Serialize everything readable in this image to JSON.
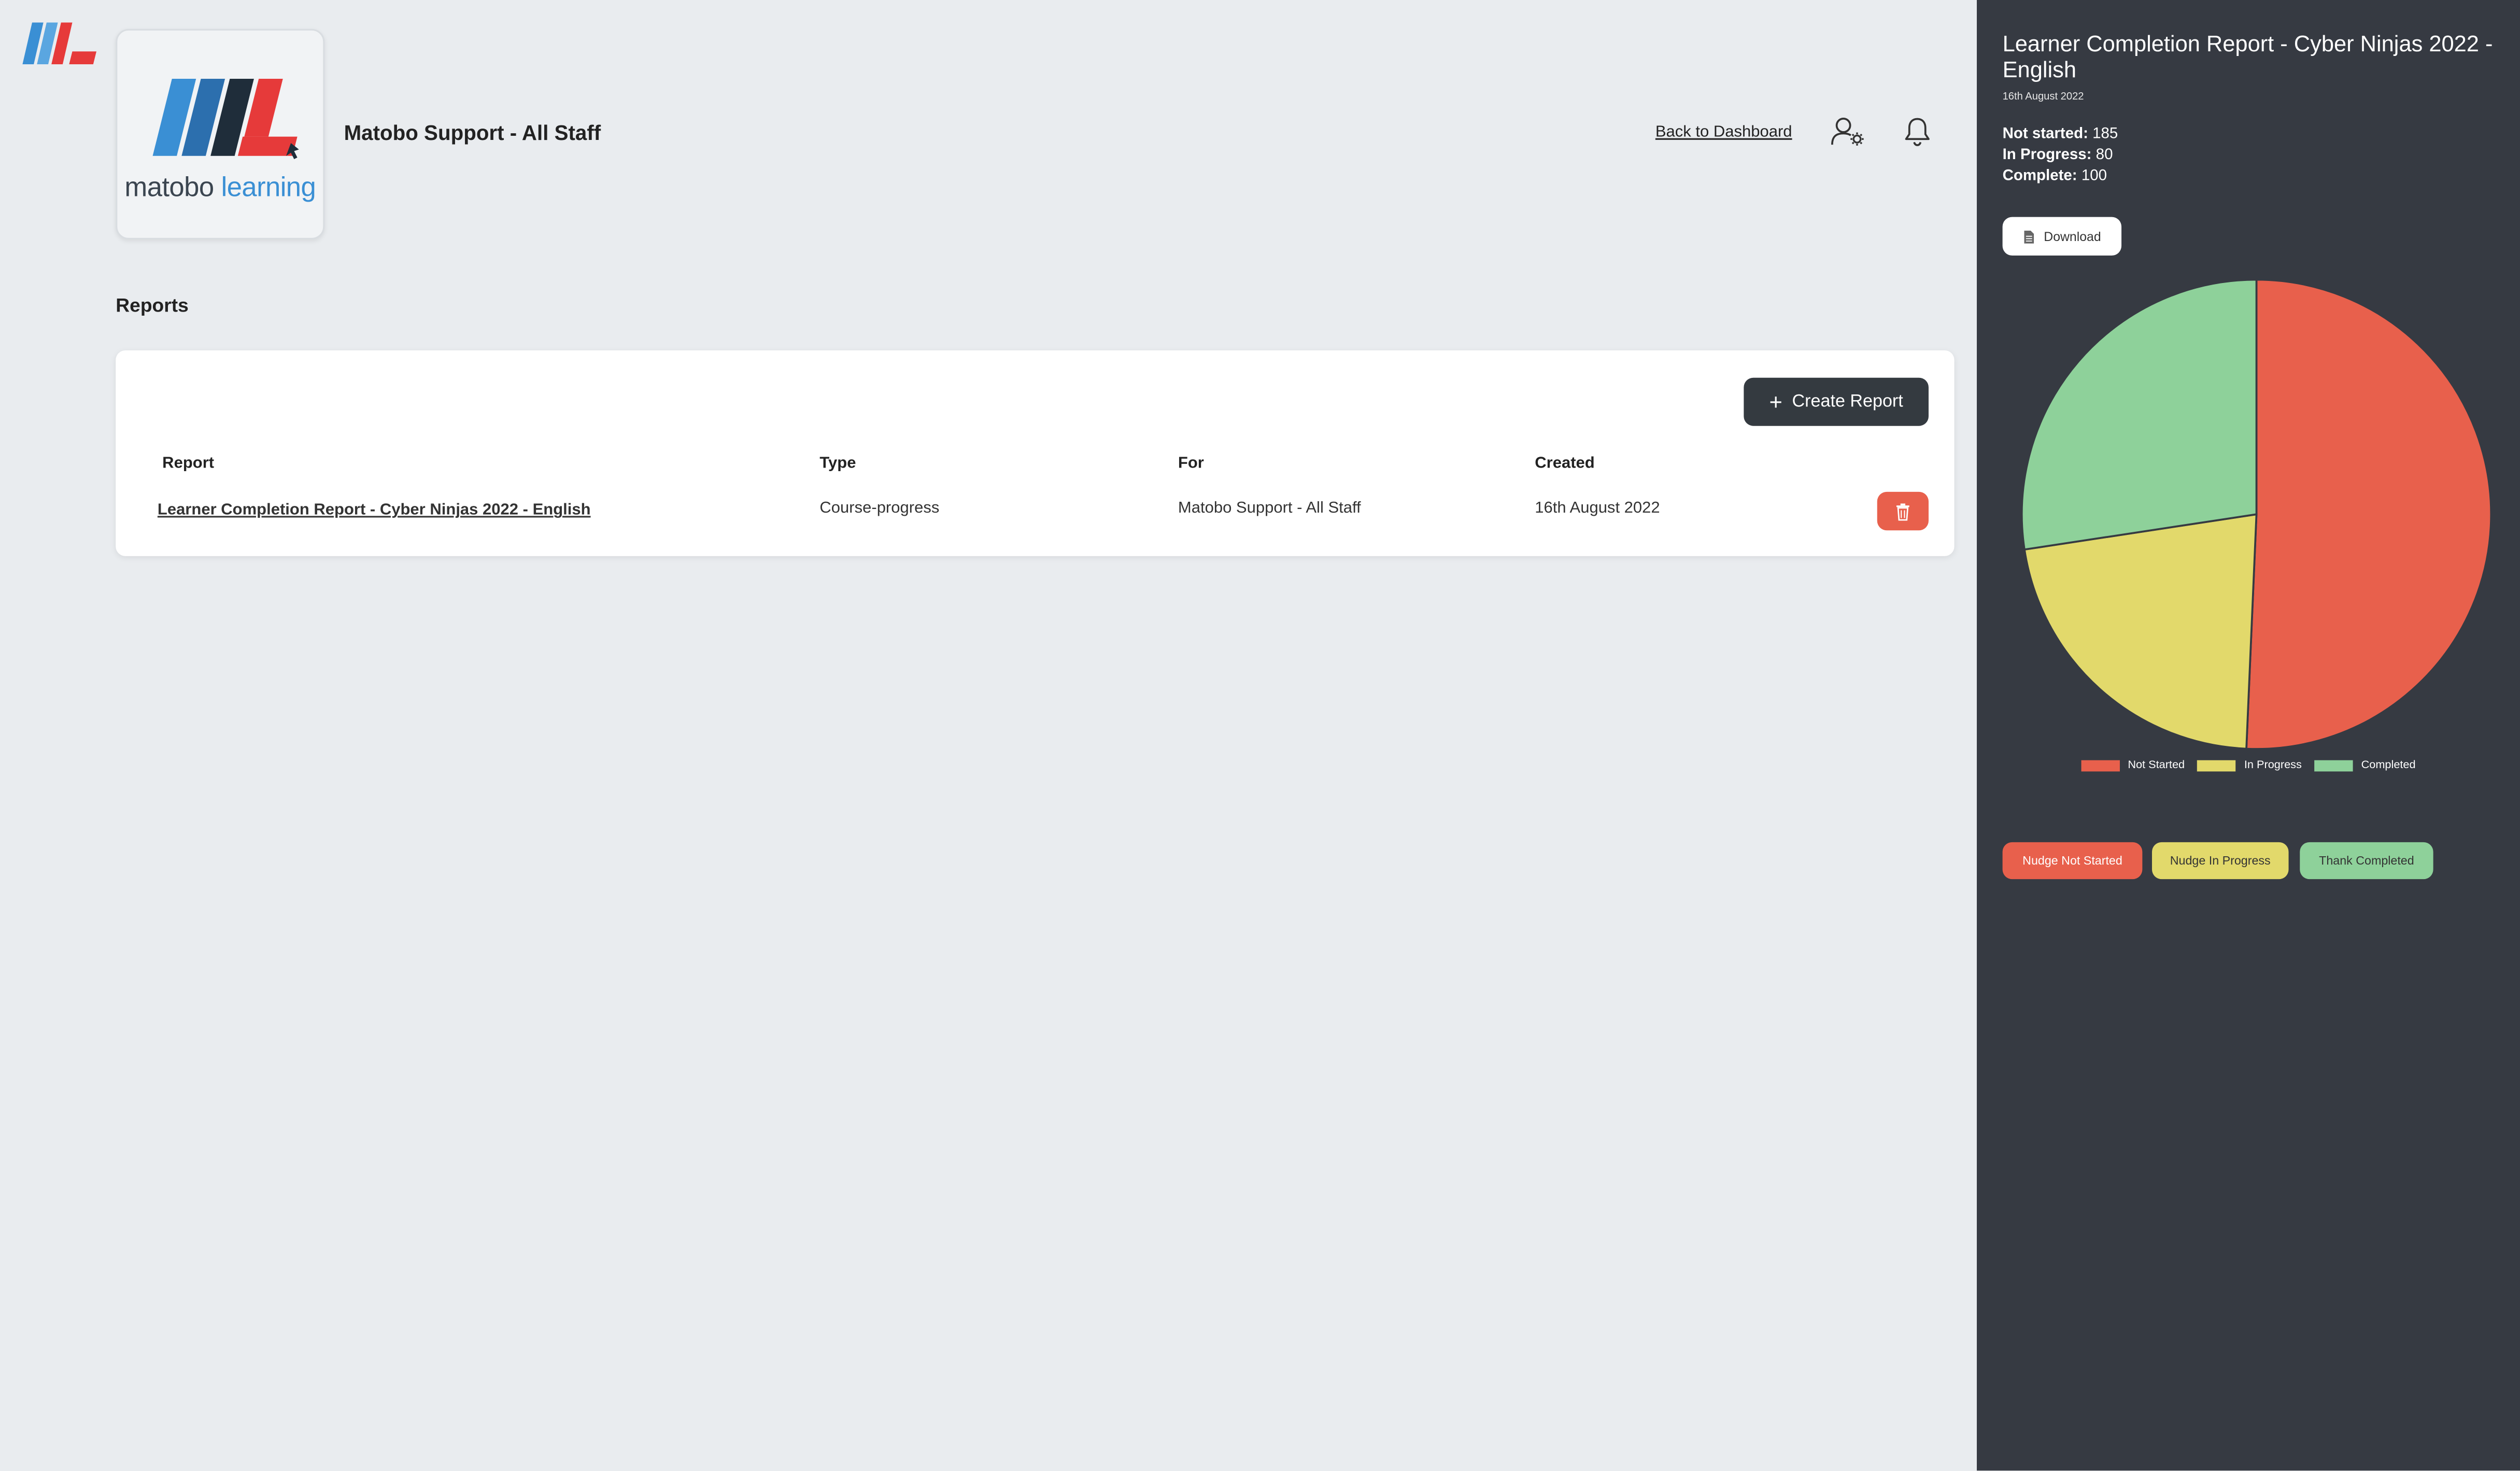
{
  "header": {
    "org_name": "Matobo Support - All Staff",
    "back_link": "Back to Dashboard",
    "logo_text_1": "matobo",
    "logo_text_2": "learning"
  },
  "reports": {
    "section_title": "Reports",
    "create_button": "Create Report",
    "columns": [
      "Report",
      "Type",
      "For",
      "Created"
    ],
    "rows": [
      {
        "report": "Learner Completion Report - Cyber Ninjas 2022 - English",
        "type": "Course-progress",
        "for": "Matobo Support - All Staff",
        "created": "16th August 2022"
      }
    ]
  },
  "panel": {
    "title": "Learner Completion Report - Cyber Ninjas 2022 - English",
    "date": "16th August 2022",
    "stats": [
      {
        "label": "Not started:",
        "value": "185"
      },
      {
        "label": "In Progress:",
        "value": "80"
      },
      {
        "label": "Complete:",
        "value": "100"
      }
    ],
    "download_label": "Download",
    "nudge_not_started": "Nudge Not Started",
    "nudge_in_progress": "Nudge In Progress",
    "thank_completed": "Thank Completed"
  },
  "chart_data": {
    "type": "pie",
    "categories": [
      "Not Started",
      "In Progress",
      "Completed"
    ],
    "values": [
      185,
      80,
      100
    ],
    "colors": [
      "#e8604c",
      "#e2d96b",
      "#8ed19a"
    ],
    "legend": "bottom"
  },
  "colors": {
    "panel_bg": "#363a42",
    "page_bg": "#e9ecef",
    "primary_dark": "#343a40",
    "danger": "#e8604c",
    "warning": "#e2d96b",
    "success": "#8ed19a",
    "brand_blue": "#3a8fd4",
    "brand_red": "#e63a3a"
  },
  "icons": {
    "user_settings": "user-gear-icon",
    "notifications": "bell-icon",
    "delete": "trash-icon",
    "download": "document-icon",
    "create": "plus-icon"
  }
}
